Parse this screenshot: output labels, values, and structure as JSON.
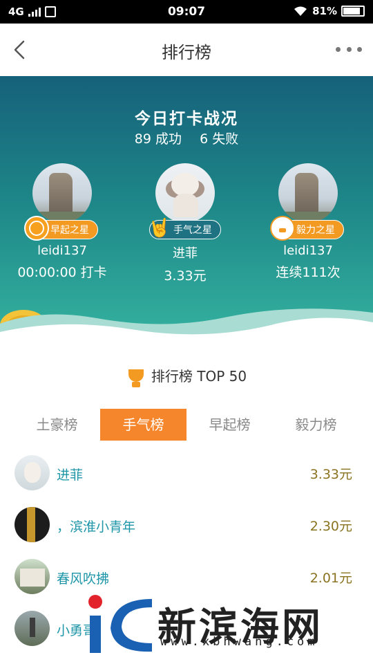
{
  "status_bar": {
    "network": "4G",
    "time": "09:07",
    "battery": "81%"
  },
  "nav": {
    "title": "排行榜"
  },
  "summary": {
    "title": "今日打卡战况",
    "success": "89 成功",
    "fail": "6 失败"
  },
  "stars": [
    {
      "badge": "早起之星",
      "name": "leidi137",
      "value": "00:00:00 打卡",
      "icon": "clock-icon"
    },
    {
      "badge": "手气之星",
      "name": "进菲",
      "value": "3.33元",
      "icon": "hand-icon"
    },
    {
      "badge": "毅力之星",
      "name": "leidi137",
      "value": "连续111次",
      "icon": "chick-icon"
    }
  ],
  "ranking": {
    "title": "排行榜 TOP 50",
    "tabs": [
      "土豪榜",
      "手气榜",
      "早起榜",
      "毅力榜"
    ],
    "active_tab": 1,
    "rows": [
      {
        "name": "进菲",
        "value": "3.33元"
      },
      {
        "name": "，滨淮小青年",
        "value": "2.30元"
      },
      {
        "name": "春风吹拂",
        "value": "2.01元"
      },
      {
        "name": "小勇哥",
        "value": ""
      }
    ]
  },
  "colors": {
    "accent": "#f6862b",
    "name_link": "#1e96a8",
    "amount": "#8a7320",
    "hero_top": "#16617a",
    "hero_bottom": "#35b3a0"
  },
  "watermark": {
    "name": "新滨海网",
    "url": "www.xbhwang.com"
  }
}
